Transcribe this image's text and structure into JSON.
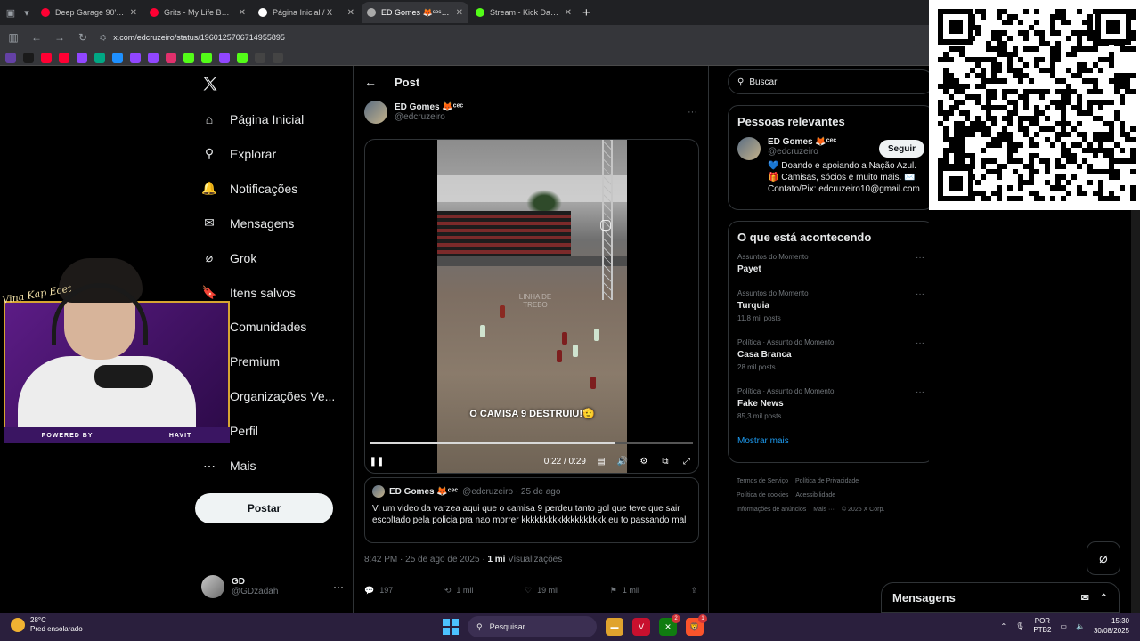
{
  "browser": {
    "tabs": [
      {
        "title": "Deep Garage 90's Hou",
        "color": "#ff0033",
        "active": false
      },
      {
        "title": "Grits - My Life Be Like",
        "color": "#ff0033",
        "active": false
      },
      {
        "title": "Página Inicial / X",
        "color": "#ffffff",
        "active": false
      },
      {
        "title": "ED Gomes 🦊ᶜᵉᶜ no X:",
        "color": "#aaaaaa",
        "active": true
      },
      {
        "title": "Stream - Kick Dashboa",
        "color": "#53fc18",
        "active": false
      }
    ],
    "new_tab": "+",
    "url": "x.com/edcruzeiro/status/1960125706714955895",
    "bookmark_colors": [
      "#6441a5",
      "#1a1a1a",
      "#ff0033",
      "#ff0033",
      "#9146ff",
      "#00a884",
      "#1e90ff",
      "#9146ff",
      "#9146ff",
      "#e1306c",
      "#53fc18",
      "#53fc18",
      "#9146ff",
      "#53fc18",
      "#444444",
      "#444444"
    ]
  },
  "nav": {
    "items": [
      {
        "label": "Página Inicial",
        "icon": "home-icon",
        "glyph": "⌂"
      },
      {
        "label": "Explorar",
        "icon": "search-icon",
        "glyph": "⚲"
      },
      {
        "label": "Notificações",
        "icon": "bell-icon",
        "glyph": "🔔"
      },
      {
        "label": "Mensagens",
        "icon": "mail-icon",
        "glyph": "✉"
      },
      {
        "label": "Grok",
        "icon": "grok-icon",
        "glyph": "⌀"
      },
      {
        "label": "Itens salvos",
        "icon": "bookmark-icon",
        "glyph": "🔖"
      },
      {
        "label": "Comunidades",
        "icon": "communities-icon",
        "glyph": "👥"
      },
      {
        "label": "Premium",
        "icon": "premium-icon",
        "glyph": "✕"
      },
      {
        "label": "Organizações Ve...",
        "icon": "verified-orgs-icon",
        "glyph": "⚡"
      },
      {
        "label": "Perfil",
        "icon": "profile-icon",
        "glyph": "👤"
      },
      {
        "label": "Mais",
        "icon": "more-icon",
        "glyph": "⋯"
      }
    ],
    "post_button": "Postar",
    "account": {
      "name": "GD",
      "handle": "@GDzadah"
    }
  },
  "post": {
    "header_title": "Post",
    "author_name": "ED Gomes 🦊ᶜᵉᶜ",
    "author_handle": "@edcruzeiro",
    "video": {
      "caption": "O CAMISA 9 DESTRUIU!🫡",
      "watermark": "LINHA DE TREBO",
      "time": "0:22 / 0:29",
      "progress": 0.76
    },
    "quote": {
      "author_name": "ED Gomes 🦊ᶜᵉᶜ",
      "meta": "@edcruzeiro · 25 de ago",
      "text": "Vi um video da varzea aqui que o camisa 9 perdeu tanto gol que teve que sair escoltado pela policia pra nao morrer kkkkkkkkkkkkkkkkkkk eu to passando mal"
    },
    "timestamp": "8:42 PM · 25 de ago de 2025 · ",
    "views_count": "1 mi",
    "views_label": " Visualizações",
    "actions": {
      "replies": "197",
      "reposts": "1 mil",
      "likes": "19 mil",
      "bookmarks": "1 mil"
    }
  },
  "sidebar": {
    "search_placeholder": "Buscar",
    "relevant_title": "Pessoas relevantes",
    "person": {
      "name": "ED Gomes 🦊ᶜᵉᶜ",
      "handle": "@edcruzeiro",
      "follow": "Seguir",
      "bio": "💙 Doando e apoiando a Nação Azul. 🎁 Camisas, sócios e muito mais. ✉️ Contato/Pix: edcruzeiro10@gmail.com"
    },
    "trends_title": "O que está acontecendo",
    "trends": [
      {
        "context": "Assuntos do Momento",
        "name": "Payet",
        "count": ""
      },
      {
        "context": "Assuntos do Momento",
        "name": "Turquia",
        "count": "11,8 mil posts"
      },
      {
        "context": "Política · Assunto do Momento",
        "name": "Casa Branca",
        "count": "28 mil posts"
      },
      {
        "context": "Política · Assunto do Momento",
        "name": "Fake News",
        "count": "85,3 mil posts"
      }
    ],
    "show_more": "Mostrar mais",
    "footer": [
      "Termos de Serviço",
      "Política de Privacidade",
      "Política de cookies",
      "Acessibilidade",
      "Informações de anúncios",
      "Mais ···",
      "© 2025 X Corp."
    ],
    "messages_label": "Mensagens"
  },
  "stream": {
    "brand_left": "POWERED BY",
    "brand_mid": "HAVIT",
    "signature": "Vina Kap Ecet"
  },
  "taskbar": {
    "temp": "28°C",
    "weather": "Pred ensolarado",
    "search": "Pesquisar",
    "lang_top": "POR",
    "lang_bottom": "PTB2",
    "time": "15:30",
    "date": "30/08/2025",
    "edge_badge": "2",
    "brave_badge": "1"
  }
}
